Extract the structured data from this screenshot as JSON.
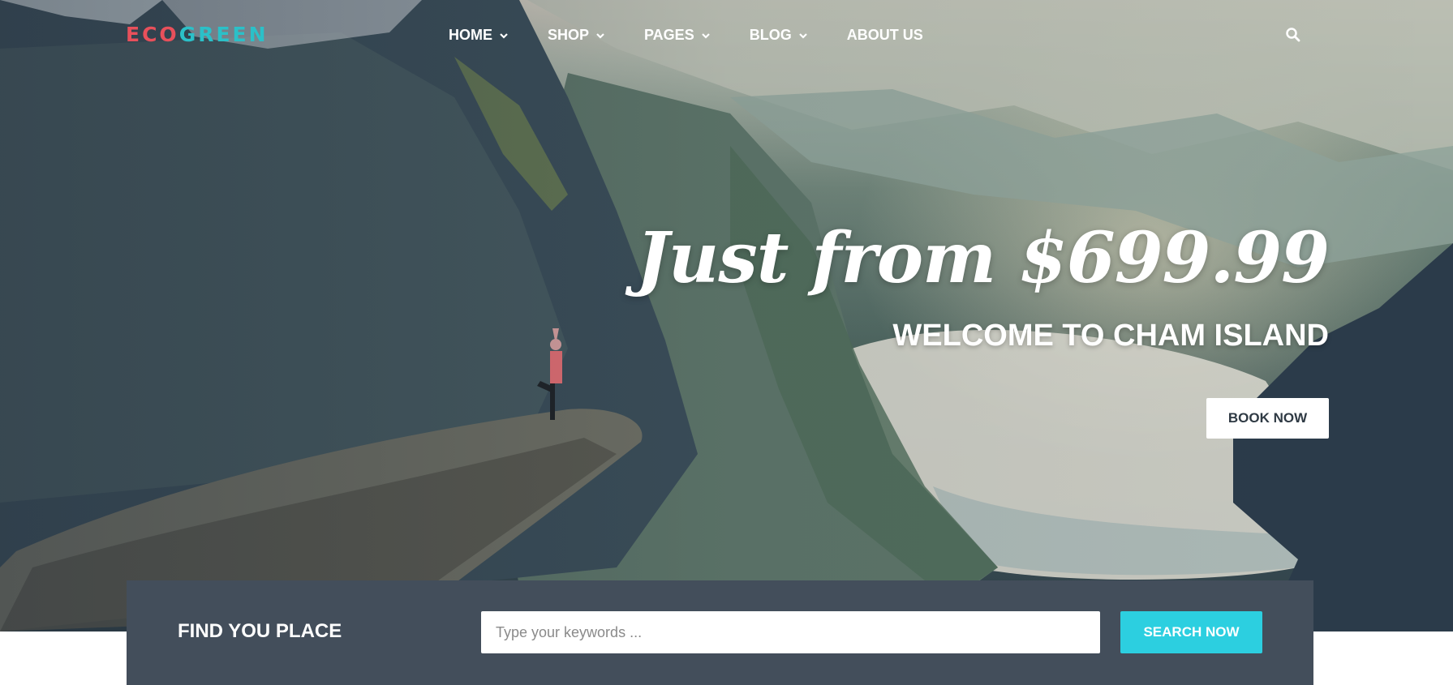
{
  "brand": {
    "logo_part1": "ECO",
    "logo_part2": "GREEN",
    "color_part1": "#e8505b",
    "color_part2": "#2bc0c8"
  },
  "nav": {
    "items": [
      {
        "label": "HOME",
        "has_dropdown": true
      },
      {
        "label": "SHOP",
        "has_dropdown": true
      },
      {
        "label": "PAGES",
        "has_dropdown": true
      },
      {
        "label": "BLOG",
        "has_dropdown": true
      },
      {
        "label": "ABOUT US",
        "has_dropdown": false
      }
    ],
    "search_icon": "search-icon"
  },
  "hero": {
    "headline": "Just from $699.99",
    "subheadline": "WELCOME TO CHAM ISLAND",
    "cta_label": "BOOK NOW"
  },
  "find": {
    "title": "FIND YOU PLACE",
    "input_placeholder": "Type your keywords ...",
    "input_value": "",
    "button_label": "SEARCH NOW",
    "button_color": "#2ccfe0",
    "bar_color": "#434e5b"
  }
}
